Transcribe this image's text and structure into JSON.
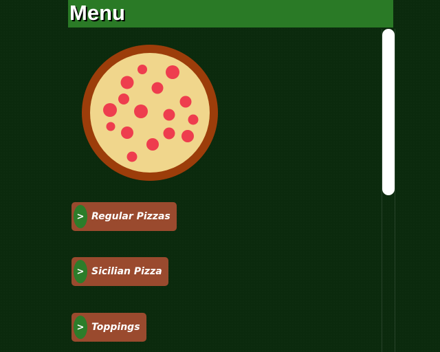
{
  "header": {
    "title": "Menu"
  },
  "hero": {
    "image": "pizza-illustration"
  },
  "menu": {
    "items": [
      {
        "label": "Regular Pizzas",
        "icon": ">"
      },
      {
        "label": "Sicilian Pizza",
        "icon": ">"
      },
      {
        "label": "Toppings",
        "icon": ">"
      }
    ]
  },
  "colors": {
    "background": "#0b2a0d",
    "header": "#2a7a26",
    "button": "#9a4a2e",
    "button_icon": "#2c7d2a",
    "crust": "#9c3d0a",
    "cheese": "#f0d68c",
    "pepperoni": "#ee3d4e"
  }
}
